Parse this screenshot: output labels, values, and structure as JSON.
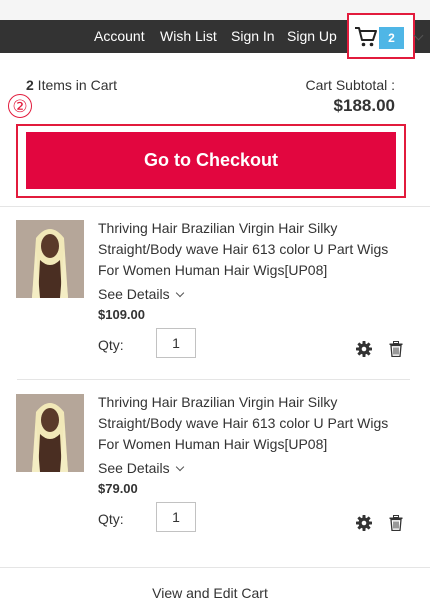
{
  "nav": {
    "links": [
      "Account",
      "Wish List",
      "Sign In",
      "Sign Up"
    ],
    "cart_count": "2"
  },
  "summary": {
    "items_count": "2",
    "items_label": " Items in Cart",
    "subtotal_label": "Cart Subtotal :",
    "subtotal_value": "$188.00"
  },
  "step_marker": "②",
  "checkout_label": "Go to Checkout",
  "products": [
    {
      "name": "Thriving Hair Brazilian Virgin Hair Silky Straight/Body wave Hair 613 color U Part Wigs For Women Human Hair Wigs[UP08]",
      "details_label": "See Details",
      "price": "$109.00",
      "qty_label": "Qty:",
      "qty": "1"
    },
    {
      "name": "Thriving Hair Brazilian Virgin Hair Silky Straight/Body wave Hair 613 color U Part Wigs For Women Human Hair Wigs[UP08]",
      "details_label": "See Details",
      "price": "$79.00",
      "qty_label": "Qty:",
      "qty": "1"
    }
  ],
  "view_edit_label": "View and Edit Cart",
  "colors": {
    "accent": "#e2063f",
    "cart_badge": "#4fb6e6",
    "navbar": "#333333"
  },
  "icons": [
    "cart-icon",
    "gear-icon",
    "trash-icon",
    "chevron-down-icon"
  ]
}
